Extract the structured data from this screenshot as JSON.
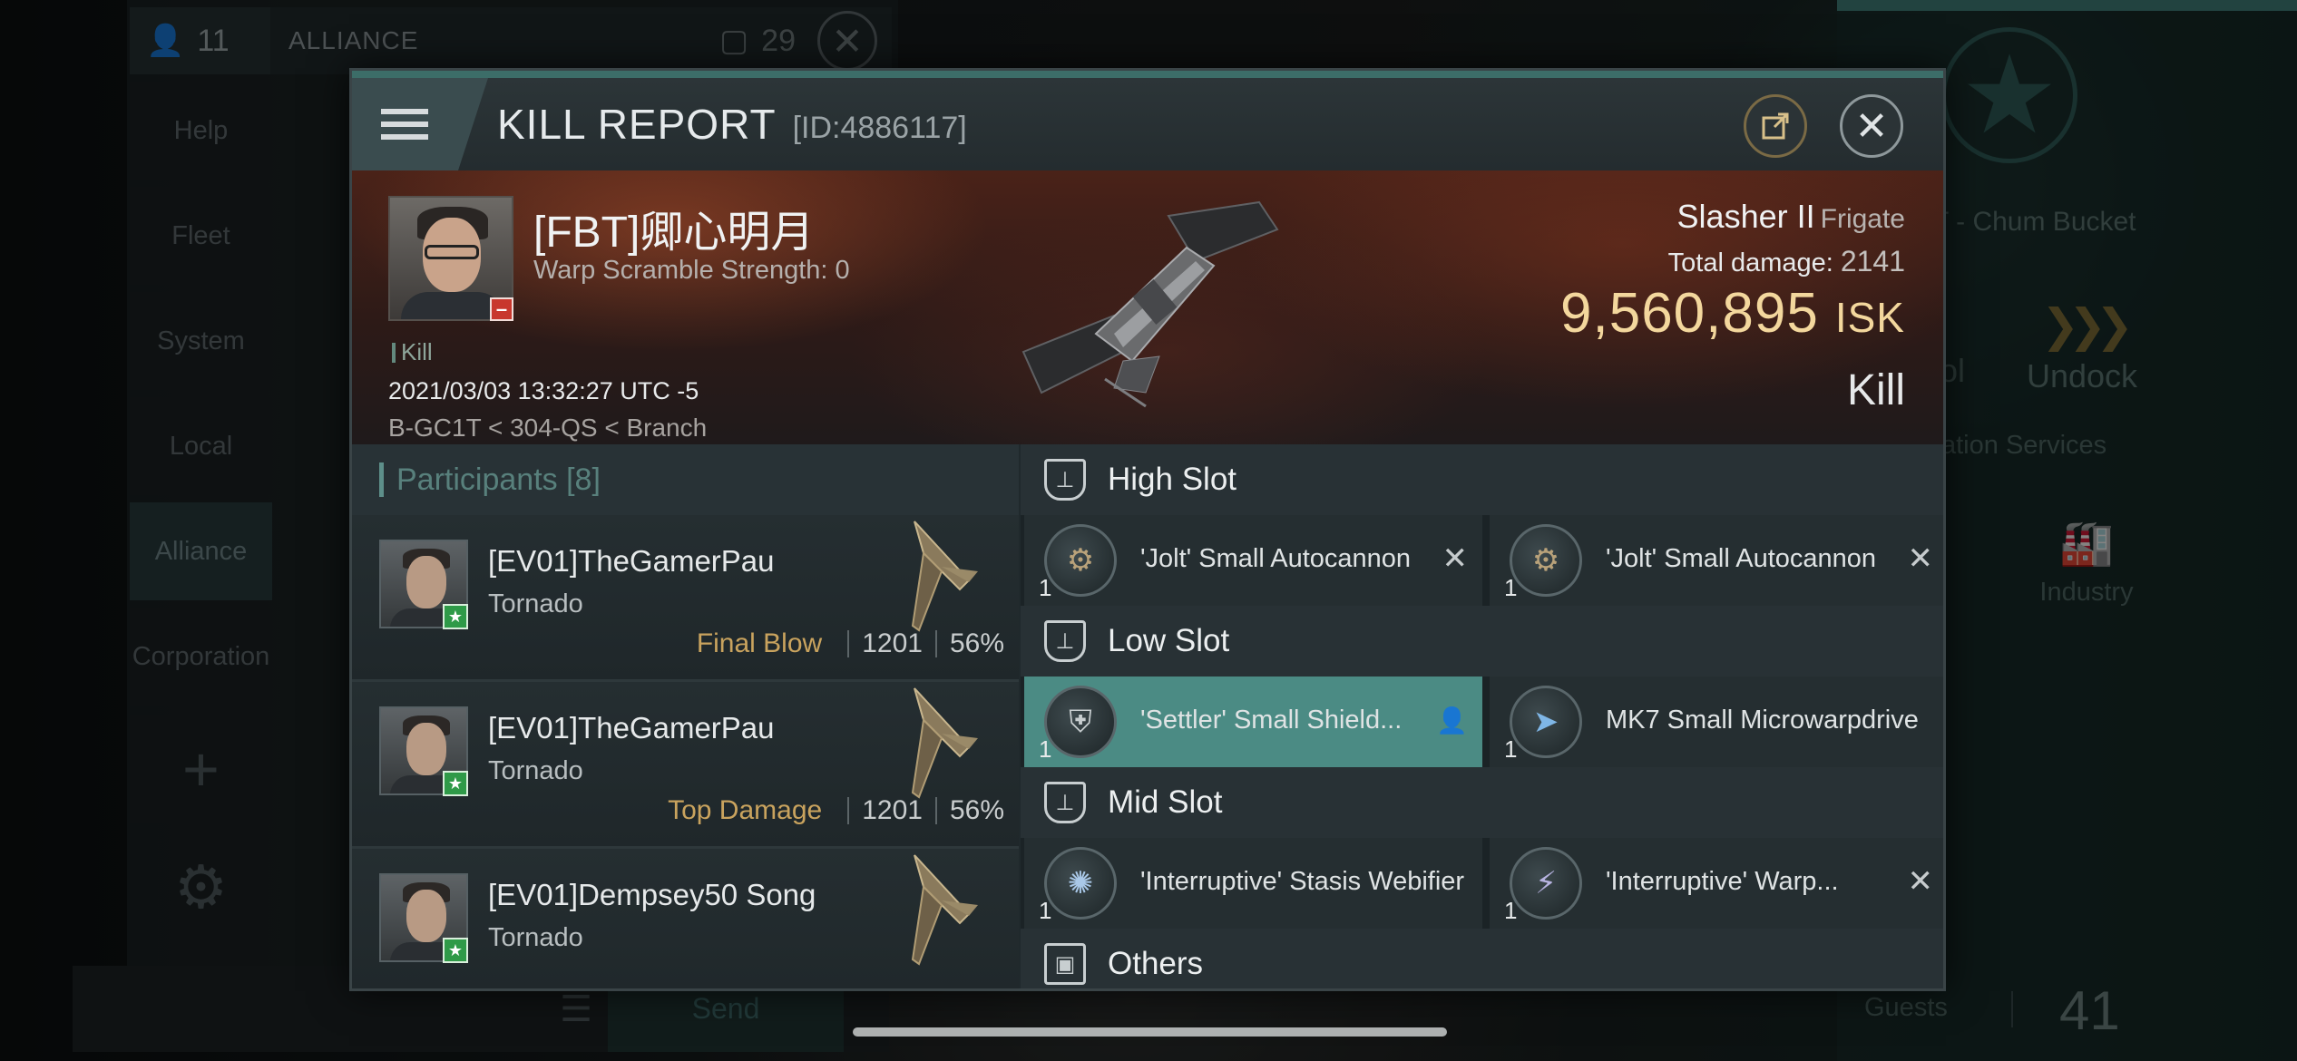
{
  "background": {
    "alliance_panel": {
      "member_count": "11",
      "title": "ALLIANCE",
      "badge_count": "29"
    },
    "side_nav": [
      "Help",
      "Fleet",
      "System",
      "Local",
      "Alliance",
      "Corporation"
    ],
    "chat_send": "Send",
    "station": {
      "name": "T - Chum Bucket",
      "undock": "Undock",
      "partial_label": "ol",
      "services": "ation Services",
      "industry": "Industry",
      "guests_label": "Guests",
      "guests_count": "41"
    }
  },
  "kill_report": {
    "title": "KILL REPORT",
    "id": "[ID:4886117]",
    "victim": {
      "name": "[FBT]卿心明月",
      "warp_scramble": "Warp Scramble Strength: 0",
      "tag": "Kill",
      "time": "2021/03/03 13:32:27 UTC -5",
      "location": "B-GC1T < 304-QS < Branch"
    },
    "ship": {
      "name": "Slasher II",
      "class": "Frigate",
      "damage_label": "Total damage:",
      "damage_value": "2141",
      "isk_value": "9,560,895",
      "isk_unit": "ISK",
      "outcome": "Kill"
    },
    "participants": {
      "label": "Participants",
      "count": "[8]",
      "rows": [
        {
          "name": "[EV01]TheGamerPau",
          "ship": "Tornado",
          "tag": "Final Blow",
          "damage": "1201",
          "percent": "56%"
        },
        {
          "name": "[EV01]TheGamerPau",
          "ship": "Tornado",
          "tag": "Top Damage",
          "damage": "1201",
          "percent": "56%"
        },
        {
          "name": "[EV01]Dempsey50 Song",
          "ship": "Tornado",
          "tag": "",
          "damage": "",
          "percent": ""
        }
      ]
    },
    "fitting": {
      "high_slot": {
        "title": "High Slot",
        "modules": [
          {
            "name": "'Jolt' Small Autocannon",
            "qty": "1"
          },
          {
            "name": "'Jolt' Small Autocannon",
            "qty": "1"
          }
        ]
      },
      "low_slot": {
        "title": "Low Slot",
        "modules": [
          {
            "name": "'Settler' Small Shield...",
            "qty": "1"
          },
          {
            "name": "MK7 Small Microwarpdrive",
            "qty": "1"
          }
        ]
      },
      "mid_slot": {
        "title": "Mid Slot",
        "modules": [
          {
            "name": "'Interruptive' Stasis Webifier",
            "qty": "1"
          },
          {
            "name": "'Interruptive' Warp...",
            "qty": "1"
          }
        ]
      },
      "others": {
        "title": "Others"
      }
    }
  }
}
